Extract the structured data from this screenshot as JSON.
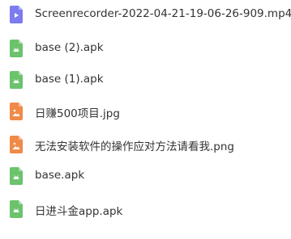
{
  "colors": {
    "video": "#7B7CF0",
    "apk": "#6CC36C",
    "image": "#F08A48",
    "text": "#333333"
  },
  "files": [
    {
      "name": "Screenrecorder-2022-04-21-19-06-26-909.mp4",
      "type": "video",
      "icon": "video-file-icon"
    },
    {
      "name": "base (2).apk",
      "type": "apk",
      "icon": "android-file-icon"
    },
    {
      "name": "base (1).apk",
      "type": "apk",
      "icon": "android-file-icon"
    },
    {
      "name": "日赚500项目.jpg",
      "type": "image",
      "icon": "image-file-icon"
    },
    {
      "name": "无法安装软件的操作应对方法请看我.png",
      "type": "image",
      "icon": "image-file-icon"
    },
    {
      "name": "base.apk",
      "type": "apk",
      "icon": "android-file-icon"
    },
    {
      "name": "日进斗金app.apk",
      "type": "apk",
      "icon": "android-file-icon"
    }
  ]
}
